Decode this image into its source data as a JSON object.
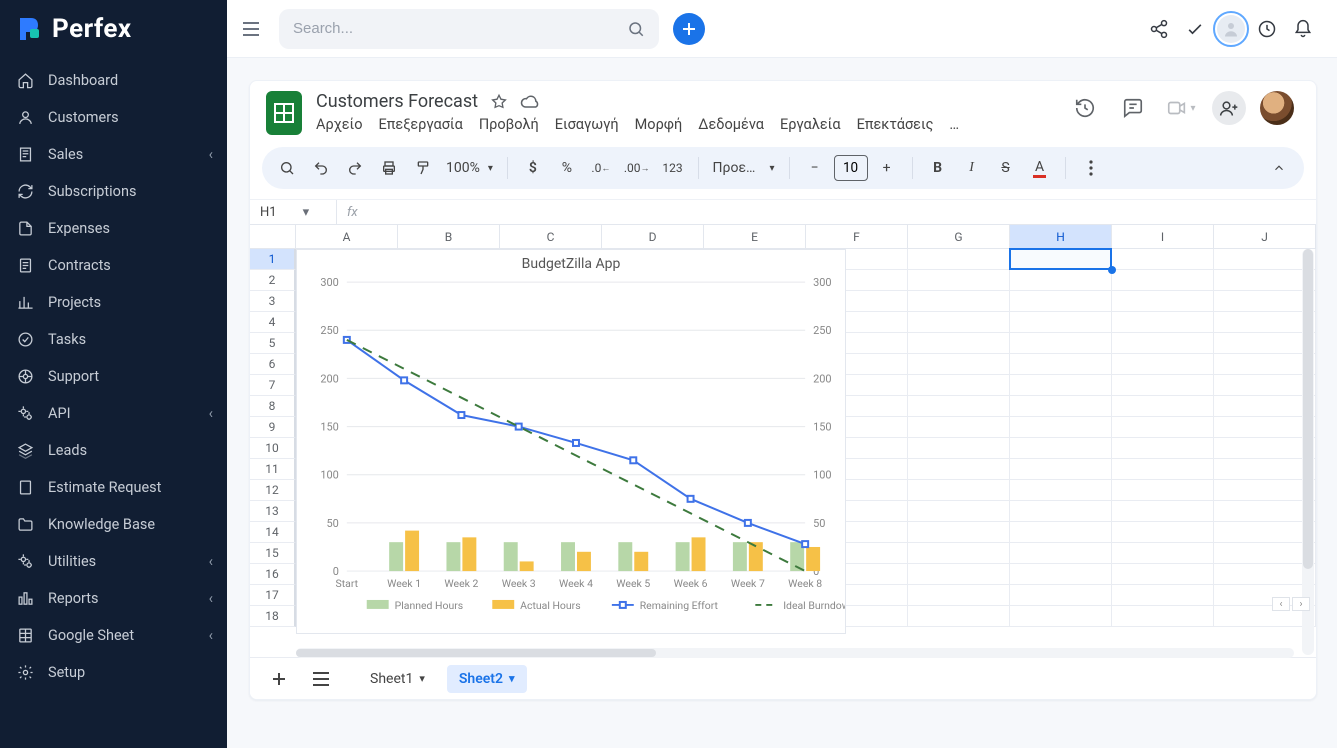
{
  "brand": "Perfex",
  "search": {
    "placeholder": "Search..."
  },
  "sidebar": {
    "items": [
      {
        "label": "Dashboard",
        "icon": "home",
        "sub": false
      },
      {
        "label": "Customers",
        "icon": "user",
        "sub": false
      },
      {
        "label": "Sales",
        "icon": "receipt",
        "sub": true
      },
      {
        "label": "Subscriptions",
        "icon": "refresh",
        "sub": false
      },
      {
        "label": "Expenses",
        "icon": "file",
        "sub": false
      },
      {
        "label": "Contracts",
        "icon": "doc",
        "sub": false
      },
      {
        "label": "Projects",
        "icon": "chart",
        "sub": false
      },
      {
        "label": "Tasks",
        "icon": "check",
        "sub": false
      },
      {
        "label": "Support",
        "icon": "life",
        "sub": false
      },
      {
        "label": "API",
        "icon": "gears",
        "sub": true
      },
      {
        "label": "Leads",
        "icon": "layers",
        "sub": false
      },
      {
        "label": "Estimate Request",
        "icon": "page",
        "sub": false
      },
      {
        "label": "Knowledge Base",
        "icon": "folder",
        "sub": false
      },
      {
        "label": "Utilities",
        "icon": "gears",
        "sub": true
      },
      {
        "label": "Reports",
        "icon": "bars",
        "sub": true
      },
      {
        "label": "Google Sheet",
        "icon": "sheet",
        "sub": true
      },
      {
        "label": "Setup",
        "icon": "gear",
        "sub": false
      }
    ]
  },
  "doc": {
    "title": "Customers Forecast",
    "menus": [
      "Αρχείο",
      "Επεξεργασία",
      "Προβολή",
      "Εισαγωγή",
      "Μορφή",
      "Δεδομένα",
      "Εργαλεία",
      "Επεκτάσεις",
      "…"
    ]
  },
  "toolbar": {
    "zoom": "100%",
    "currency_default": "Προε…",
    "font_size": "10"
  },
  "cellref": {
    "name": "H1"
  },
  "columns": [
    "A",
    "B",
    "C",
    "D",
    "E",
    "F",
    "G",
    "H",
    "I",
    "J"
  ],
  "selected_col_index": 7,
  "row_count": 18,
  "tabs": {
    "items": [
      "Sheet1",
      "Sheet2"
    ],
    "active_index": 1
  },
  "chart_data": {
    "type": "combo",
    "title": "BudgetZilla App",
    "categories": [
      "Start",
      "Week 1",
      "Week 2",
      "Week 3",
      "Week 4",
      "Week 5",
      "Week 6",
      "Week 7",
      "Week 8"
    ],
    "series": [
      {
        "name": "Planned Hours",
        "type": "bar",
        "color": "#b7d7a8",
        "values": [
          0,
          30,
          30,
          30,
          30,
          30,
          30,
          30,
          30
        ]
      },
      {
        "name": "Actual Hours",
        "type": "bar",
        "color": "#f6c147",
        "values": [
          0,
          42,
          35,
          10,
          20,
          20,
          35,
          30,
          25
        ]
      },
      {
        "name": "Remaining Effort",
        "type": "line",
        "color": "#3f72e8",
        "values": [
          240,
          198,
          162,
          150,
          133,
          115,
          75,
          50,
          28
        ]
      },
      {
        "name": "Ideal Burndown",
        "type": "line_dash",
        "color": "#3d7a3d",
        "values": [
          240,
          210,
          180,
          150,
          120,
          90,
          60,
          30,
          0
        ]
      }
    ],
    "ylim_left": [
      0,
      300
    ],
    "ylim_right": [
      0,
      300
    ],
    "y_ticks": [
      0,
      50,
      100,
      150,
      200,
      250,
      300
    ]
  }
}
